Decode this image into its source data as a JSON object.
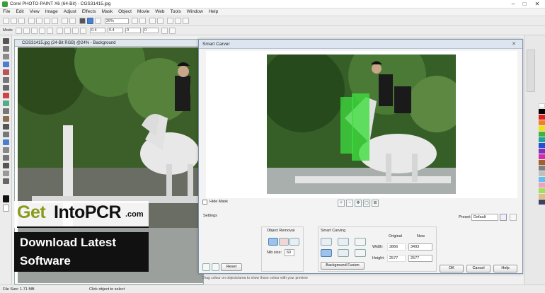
{
  "app": {
    "title": "Corel PHOTO-PAINT X6 (64-Bit) - CGS31415.jpg"
  },
  "menu": [
    "File",
    "Edit",
    "View",
    "Image",
    "Adjust",
    "Effects",
    "Mask",
    "Object",
    "Movie",
    "Web",
    "Tools",
    "Window",
    "Help"
  ],
  "toolbar": {
    "zoom": "26%",
    "mode_label": "Mode",
    "nums": [
      "0.4",
      "0.4",
      "0",
      "0"
    ]
  },
  "document": {
    "title": "CGS31415.jpg (24-Bit RGB) @24% - Background"
  },
  "dialog": {
    "title": "Smart Carver",
    "hide_mask": "Hide Mask",
    "settings": "Settings",
    "preset_label": "Preset:",
    "preset_value": "Default",
    "object_removal": "Object Removal",
    "nib_size_label": "Nib size:",
    "nib_size_value": "60",
    "smart_carving": "Smart Carving",
    "original": "Original",
    "new": "New",
    "width_label": "Width:",
    "height_label": "Height:",
    "width_orig": "3866",
    "width_new": "3493",
    "height_orig": "2577",
    "height_new": "2577",
    "background_fusion": "Background Fusion",
    "reset": "Reset",
    "ok": "OK",
    "cancel": "Cancel",
    "help": "Help",
    "hint": "Drag colour on objects/area to show those colour with your preview"
  },
  "status": {
    "file_size": "File Size: 1.71 MB",
    "hint": "Click object to select"
  },
  "watermark": {
    "brand_a": "Get",
    "brand_b": "IntoPCR",
    "dotcom": ".com",
    "line1": "Download Latest",
    "line2": "Software"
  }
}
